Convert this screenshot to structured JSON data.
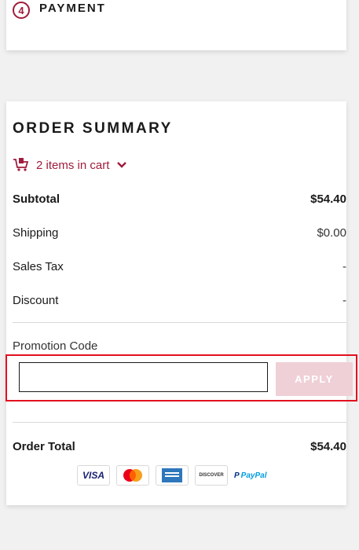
{
  "checkout_step": {
    "number": "4",
    "label": "PAYMENT"
  },
  "summary": {
    "title": "ORDER SUMMARY",
    "cart_toggle": "2 items in cart",
    "rows": [
      {
        "label": "Subtotal",
        "value": "$54.40"
      },
      {
        "label": "Shipping",
        "value": "$0.00"
      },
      {
        "label": "Sales Tax",
        "value": "-"
      },
      {
        "label": "Discount",
        "value": "-"
      }
    ],
    "promo": {
      "label": "Promotion Code",
      "value": "",
      "placeholder": "",
      "apply_label": "APPLY"
    },
    "total": {
      "label": "Order Total",
      "value": "$54.40"
    }
  },
  "payment_methods": {
    "visa": "VISA",
    "discover": "DISCOVER",
    "paypal_1": "P",
    "paypal_2": "PayPal"
  },
  "colors": {
    "accent": "#a01b3c",
    "apply_bg": "#efd0d6",
    "highlight": "#e3101e"
  },
  "icons": [
    "cart-icon",
    "chevron-down-icon",
    "mastercard-icon",
    "amex-icon"
  ]
}
